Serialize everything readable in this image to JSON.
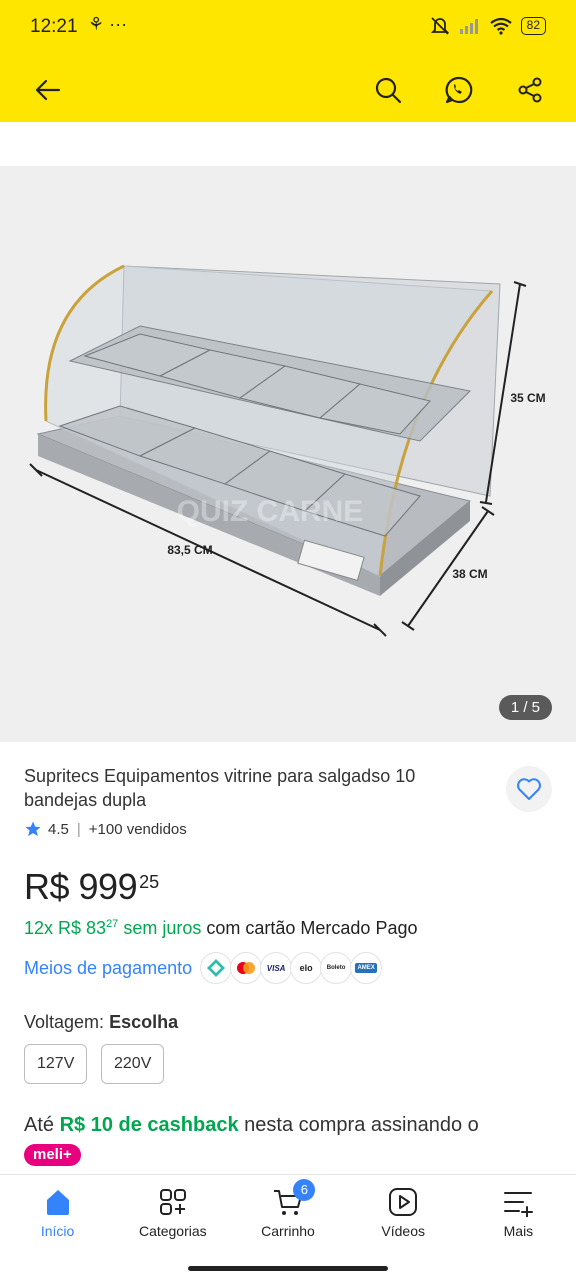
{
  "status_bar": {
    "time": "12:21",
    "extra_icons": "⚘ ···",
    "battery": "82"
  },
  "header": {
    "back_icon": "arrow-left-icon",
    "search_icon": "search-icon",
    "whatsapp_icon": "whatsapp-icon",
    "share_icon": "share-icon"
  },
  "gallery": {
    "counter": "1 / 5",
    "dimensions": {
      "width": "83,5 CM",
      "height": "35 CM",
      "depth": "38 CM"
    },
    "watermark": "QUIZ CARNE"
  },
  "product": {
    "title": "Supritecs Equipamentos vitrine para salgadso 10 bandejas dupla",
    "rating": "4.5",
    "sold": "+100 vendidos",
    "price_main": "R$ 999",
    "price_cents": "25",
    "installments_prefix": "12x R$ 83",
    "installments_cents": "27",
    "installments_suffix": "sem juros",
    "installments_tail": "com cartão Mercado Pago",
    "payment_link": "Meios de pagamento",
    "payment_methods": [
      "pix",
      "mastercard",
      "VISA",
      "elo",
      "Boleto",
      "AMEX"
    ]
  },
  "voltage": {
    "label": "Voltagem:",
    "value": "Escolha",
    "options": [
      "127V",
      "220V"
    ]
  },
  "cashback": {
    "prefix": "Até",
    "amount": "R$ 10 de cashback",
    "middle": "nesta compra assinando o",
    "badge": "meli+"
  },
  "bottom_nav": {
    "items": [
      {
        "label": "Início",
        "icon": "home-icon",
        "active": true
      },
      {
        "label": "Categorias",
        "icon": "categories-icon"
      },
      {
        "label": "Carrinho",
        "icon": "cart-icon",
        "badge": "6"
      },
      {
        "label": "Vídeos",
        "icon": "play-icon"
      },
      {
        "label": "Mais",
        "icon": "menu-plus-icon"
      }
    ]
  },
  "colors": {
    "yellow": "#ffe600",
    "blue": "#3483fa",
    "green": "#00a650",
    "pink": "#e8007f"
  }
}
